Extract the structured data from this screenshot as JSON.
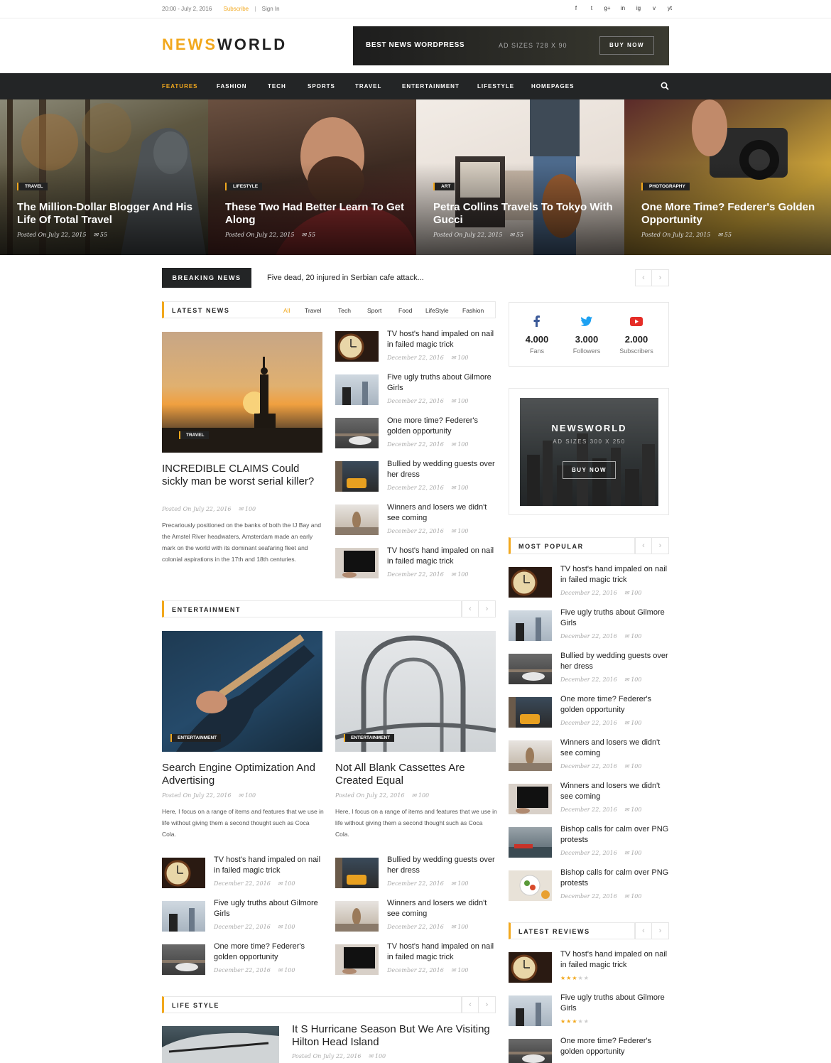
{
  "topbar": {
    "datetime": "20:00 - July 2, 2016",
    "subscribe": "Subscribe",
    "separator": "|",
    "signin": "Sign In",
    "socials": [
      "f",
      "t",
      "g+",
      "in",
      "ig",
      "v",
      "yt"
    ]
  },
  "logo": {
    "part1": "NEWS",
    "part2": "WORLD"
  },
  "header_ad": {
    "title": "BEST NEWS WORDPRESS",
    "sizes": "AD SIZES 728 X 90",
    "button": "BUY NOW"
  },
  "nav": {
    "items": [
      "FEATURES",
      "FASHION",
      "TECH",
      "SPORTS",
      "TRAVEL",
      "ENTERTAINMENT",
      "LIFESTYLE",
      "HOMEPAGES"
    ],
    "active": "FEATURES",
    "search_icon": "search-icon"
  },
  "hero": [
    {
      "category": "TRAVEL",
      "title": "The Million-Dollar Blogger And His Life Of Total Travel",
      "date": "Posted On July 22, 2015",
      "comments": "55"
    },
    {
      "category": "LIFESTYLE",
      "title": "These Two Had Better Learn To Get Along",
      "date": "Posted On July 22, 2015",
      "comments": "55"
    },
    {
      "category": "ART",
      "title": "Petra Collins Travels To Tokyo With Gucci",
      "date": "Posted On July 22, 2015",
      "comments": "55"
    },
    {
      "category": "PHOTOGRAPHY",
      "title": "One More Time? Federer's Golden Opportunity",
      "date": "Posted On July 22, 2015",
      "comments": "55"
    }
  ],
  "breaking": {
    "label": "BREAKING NEWS",
    "text": "Five dead, 20 injured in Serbian cafe attack...",
    "prev": "‹",
    "next": "›"
  },
  "latest": {
    "label": "LATEST NEWS",
    "tabs": [
      "All",
      "Travel",
      "Tech",
      "Sport",
      "Food",
      "LifeStyle",
      "Fashion"
    ],
    "main": {
      "category": "TRAVEL",
      "title": "INCREDIBLE CLAIMS Could sickly man be worst serial killer?",
      "date": "Posted On July 22, 2016",
      "comments": "100",
      "excerpt": "Precariously positioned on the banks of both the IJ Bay and the Amstel River headwaters, Amsterdam made an early mark on the world with its dominant seafaring fleet and colonial aspirations in the 17th and 18th centuries."
    },
    "list": [
      {
        "title": "TV host's hand impaled on nail in failed magic trick",
        "date": "December 22, 2016",
        "comments": "100"
      },
      {
        "title": "Five ugly truths about Gilmore Girls",
        "date": "December 22, 2016",
        "comments": "100"
      },
      {
        "title": "One more time? Federer's golden opportunity",
        "date": "December 22, 2016",
        "comments": "100"
      },
      {
        "title": "Bullied by wedding guests over her dress",
        "date": "December 22, 2016",
        "comments": "100"
      },
      {
        "title": "Winners and losers we didn't see coming",
        "date": "December 22, 2016",
        "comments": "100"
      },
      {
        "title": "TV host's hand impaled on nail in failed magic trick",
        "date": "December 22, 2016",
        "comments": "100"
      }
    ]
  },
  "entertainment": {
    "label": "ENTERTAINMENT",
    "main": [
      {
        "category": "ENTERTAINMENT",
        "title": "Search Engine Optimization And Advertising",
        "date": "Posted On July 22, 2016",
        "comments": "100",
        "excerpt": "Here, I focus on a range of items and features that we use in life without giving them a second thought such as Coca Cola."
      },
      {
        "category": "ENTERTAINMENT",
        "title": "Not All Blank Cassettes Are Created Equal",
        "date": "Posted On July 22, 2016",
        "comments": "100",
        "excerpt": "Here, I focus on a range of items and features that we use in life without giving them a second thought such as Coca Cola."
      }
    ],
    "list_left": [
      {
        "title": "TV host's hand impaled on nail in failed magic trick",
        "date": "December 22, 2016",
        "comments": "100"
      },
      {
        "title": "Five ugly truths about Gilmore Girls",
        "date": "December 22, 2016",
        "comments": "100"
      },
      {
        "title": "One more time? Federer's golden opportunity",
        "date": "December 22, 2016",
        "comments": "100"
      }
    ],
    "list_right": [
      {
        "title": "Bullied by wedding guests over her dress",
        "date": "December 22, 2016",
        "comments": "100"
      },
      {
        "title": "Winners and losers we didn't see coming",
        "date": "December 22, 2016",
        "comments": "100"
      },
      {
        "title": "TV host's hand impaled on nail in failed magic trick",
        "date": "December 22, 2016",
        "comments": "100"
      }
    ]
  },
  "lifestyle": {
    "label": "LIFE STYLE",
    "main": {
      "title": "It S Hurricane Season But We Are Visiting Hilton Head Island",
      "date": "Posted On July 22, 2016",
      "comments": "100"
    }
  },
  "social": [
    {
      "icon": "facebook-icon",
      "count": "4.000",
      "label": "Fans"
    },
    {
      "icon": "twitter-icon",
      "count": "3.000",
      "label": "Followers"
    },
    {
      "icon": "youtube-icon",
      "count": "2.000",
      "label": "Subscribers"
    }
  ],
  "sidebar_ad": {
    "title": "NEWSWORLD",
    "sizes": "AD SIZES 300 X 250",
    "button": "BUY NOW"
  },
  "popular": {
    "label": "MOST POPULAR",
    "items": [
      {
        "title": "TV host's hand impaled on nail in failed magic trick",
        "date": "December 22, 2016",
        "comments": "100"
      },
      {
        "title": "Five ugly truths about Gilmore Girls",
        "date": "December 22, 2016",
        "comments": "100"
      },
      {
        "title": "Bullied by wedding guests over her dress",
        "date": "December 22, 2016",
        "comments": "100"
      },
      {
        "title": "One more time? Federer's golden opportunity",
        "date": "December 22, 2016",
        "comments": "100"
      },
      {
        "title": "Winners and losers we didn't see coming",
        "date": "December 22, 2016",
        "comments": "100"
      },
      {
        "title": "Winners and losers we didn't see coming",
        "date": "December 22, 2016",
        "comments": "100"
      },
      {
        "title": "Bishop calls for calm over PNG protests",
        "date": "December 22, 2016",
        "comments": "100"
      },
      {
        "title": "Bishop calls for calm over PNG protests",
        "date": "December 22, 2016",
        "comments": "100"
      }
    ]
  },
  "reviews": {
    "label": "LATEST REVIEWS",
    "items": [
      {
        "title": "TV host's hand impaled on nail in failed magic trick",
        "rating": 3
      },
      {
        "title": "Five ugly truths about Gilmore Girls",
        "rating": 3
      },
      {
        "title": "One more time? Federer's golden opportunity",
        "rating": 3
      }
    ]
  },
  "colors": {
    "accent": "#f2a81d",
    "dark": "#232526"
  }
}
